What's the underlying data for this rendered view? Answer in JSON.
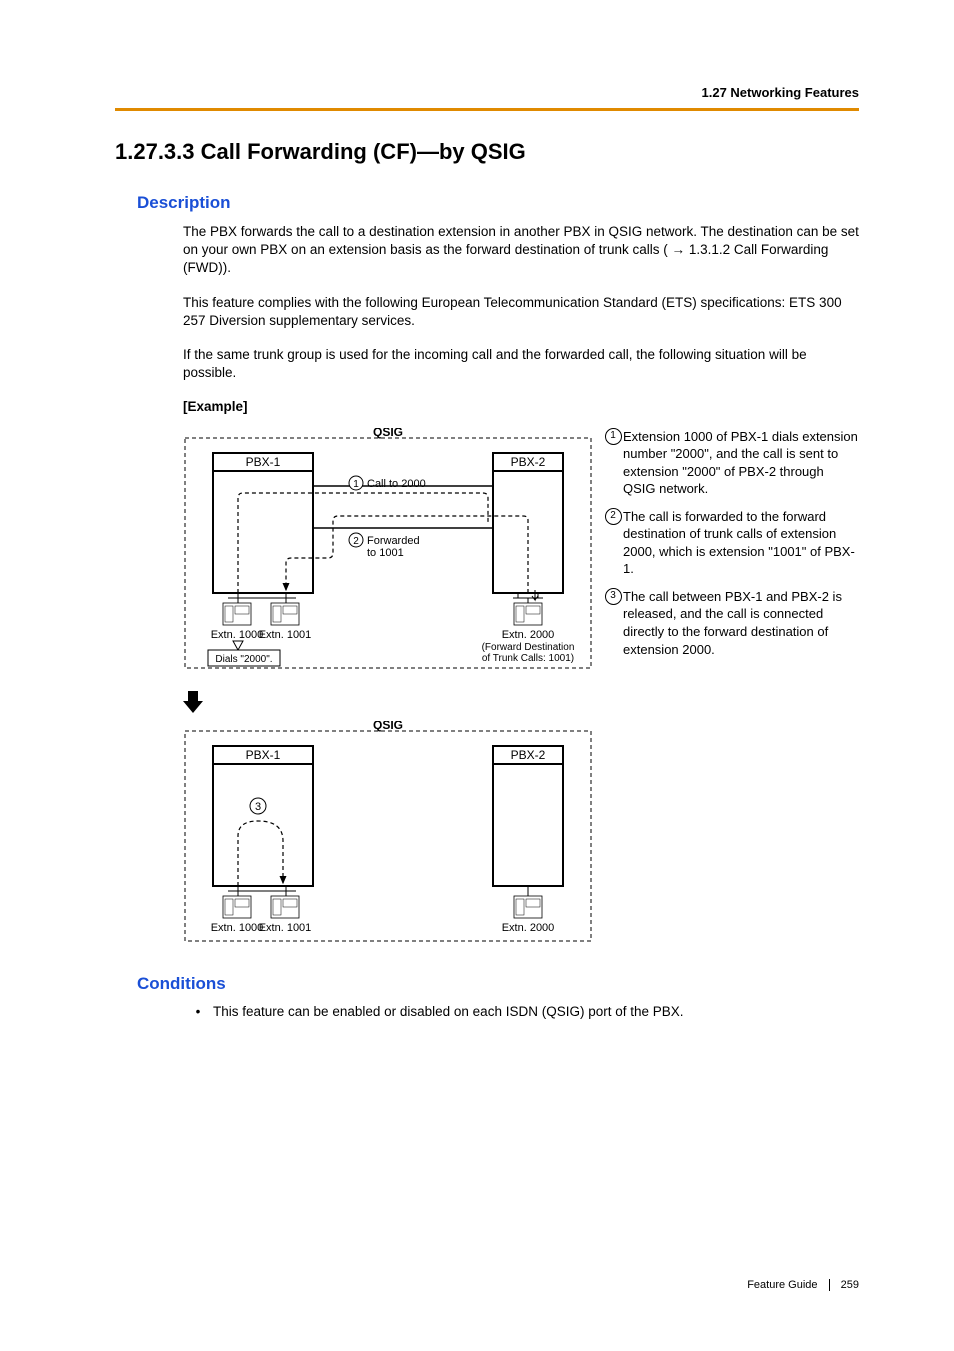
{
  "header": {
    "breadcrumb": "1.27 Networking Features"
  },
  "title": "1.27.3.3  Call Forwarding (CF)—by QSIG",
  "description": {
    "heading": "Description",
    "p1a": "The PBX forwards the call to a destination extension in another PBX in QSIG network. The destination can be set on your own PBX on an extension basis as the forward destination of trunk calls (",
    "p1link": "1.3.1.2 Call Forwarding (FWD)",
    "p1b": ").",
    "p2": "This feature complies with the following European Telecommunication Standard (ETS) specifications: ETS 300 257 Diversion supplementary services.",
    "p3": "If the same trunk group is used for the incoming call and the forwarded call, the following situation will be possible.",
    "example_label": "[Example]"
  },
  "diagram": {
    "qsig": "QSIG",
    "pbx1": "PBX-1",
    "pbx2": "PBX-2",
    "call_to": "Call to 2000",
    "forwarded_a": "Forwarded",
    "forwarded_b": "to 1001",
    "ext1000": "Extn. 1000",
    "ext1001": "Extn. 1001",
    "ext2000": "Extn. 2000",
    "fwd_dest_a": "(Forward Destination",
    "fwd_dest_b": "of Trunk Calls: 1001)",
    "dials": "Dials \"2000\".",
    "n1": "1",
    "n2": "2",
    "n3": "3"
  },
  "steps": {
    "s1": "Extension 1000 of PBX-1 dials extension number \"2000\", and the call is sent to extension \"2000\" of PBX-2 through QSIG network.",
    "s2": "The call is forwarded to the forward destination of trunk calls of extension 2000, which is extension \"1001\" of PBX-1.",
    "s3": "The call between PBX-1 and PBX-2 is released, and the call is connected directly to the forward destination of extension 2000."
  },
  "conditions": {
    "heading": "Conditions",
    "bullet1": "This feature can be enabled or disabled on each ISDN (QSIG) port of the PBX."
  },
  "footer": {
    "guide": "Feature Guide",
    "page": "259"
  }
}
